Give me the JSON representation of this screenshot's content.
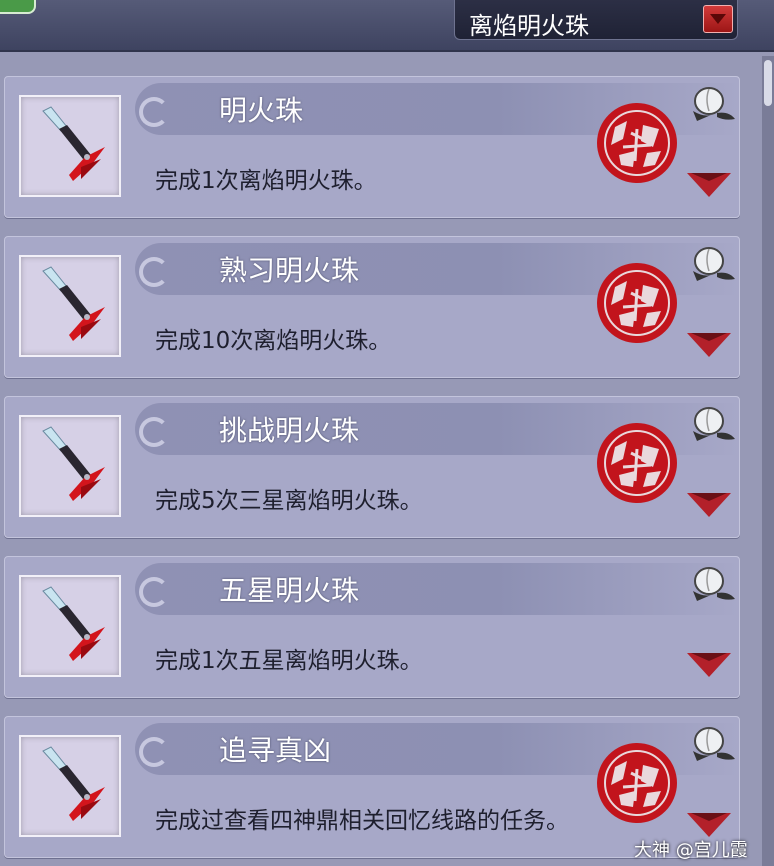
{
  "header": {
    "category_selected": "离焰明火珠"
  },
  "achievements": [
    {
      "title": "明火珠",
      "description": "完成1次离焰明火珠。",
      "completed": true
    },
    {
      "title": "熟习明火珠",
      "description": "完成10次离焰明火珠。",
      "completed": true
    },
    {
      "title": "挑战明火珠",
      "description": "完成5次三星离焰明火珠。",
      "completed": true
    },
    {
      "title": "五星明火珠",
      "description": "完成1次五星离焰明火珠。",
      "completed": false
    },
    {
      "title": "追寻真凶",
      "description": "完成过查看四神鼎相关回忆线路的任务。",
      "completed": true
    }
  ],
  "stamp_text": "完成",
  "watermark": "大神 @宫儿霞",
  "colors": {
    "stamp_red": "#c2141c",
    "arrow_red": "#b3202a",
    "card_bg": "#a7a8c8",
    "title_band": "#8f91b4"
  },
  "icons": {
    "achievement": "dagger-icon",
    "reward": "peach-icon",
    "expand": "chevron-down-icon",
    "completed": "completed-stamp-icon"
  }
}
